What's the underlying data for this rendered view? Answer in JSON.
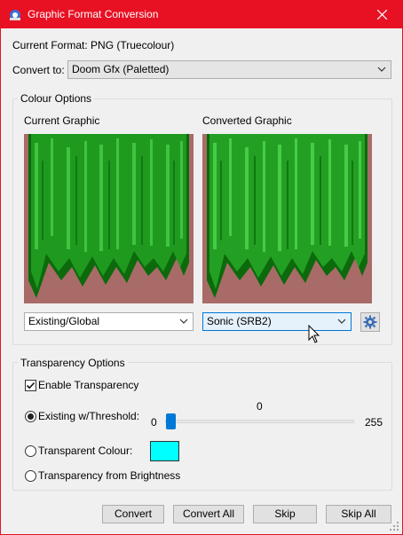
{
  "window": {
    "title": "Graphic Format Conversion",
    "title_bar_color": "#e81123"
  },
  "current_format": "Current Format: PNG (Truecolour)",
  "convert_to": {
    "label": "Convert to:",
    "selected": "Doom Gfx (Paletted)"
  },
  "colour_options": {
    "title": "Colour Options",
    "current_label": "Current Graphic",
    "converted_label": "Converted Graphic",
    "current_palette": "Existing/Global",
    "target_palette": "Sonic (SRB2)",
    "icons": {
      "settings": "gear-icon"
    }
  },
  "transparency_options": {
    "title": "Transparency Options",
    "enable_label": "Enable Transparency",
    "enable_checked": true,
    "threshold_label": "Existing w/Threshold:",
    "threshold_value": "0",
    "slider_min": "0",
    "slider_max": "255",
    "transparent_colour_label": "Transparent Colour:",
    "transparent_colour": "#00ffff",
    "brightness_label": "Transparency from Brightness"
  },
  "buttons": {
    "convert": "Convert",
    "convert_all": "Convert All",
    "skip": "Skip",
    "skip_all": "Skip All"
  },
  "colors": {
    "preview_background": "#a86b68",
    "grass_light": "#2db52d",
    "grass_dark": "#0c6a0c",
    "accent": "#0078d7"
  }
}
